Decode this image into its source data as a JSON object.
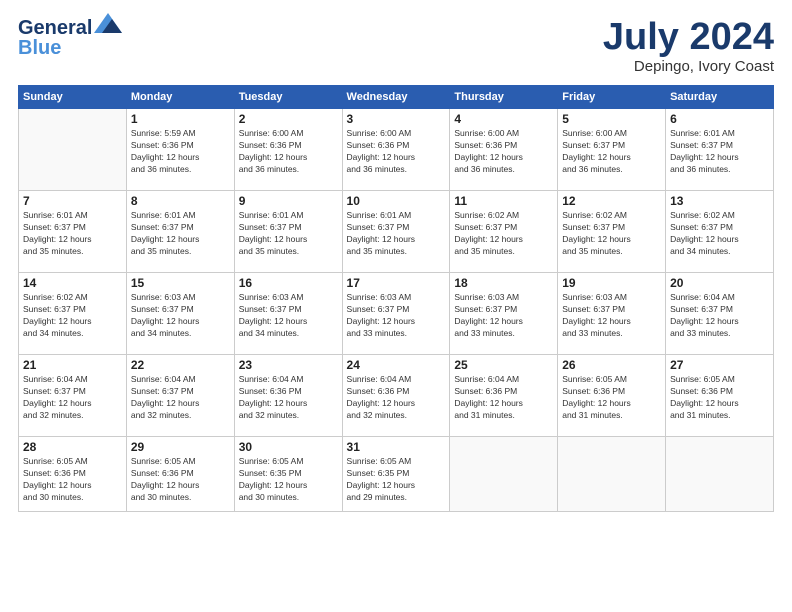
{
  "logo": {
    "line1": "General",
    "line2": "Blue"
  },
  "title": "July 2024",
  "location": "Depingo, Ivory Coast",
  "days_header": [
    "Sunday",
    "Monday",
    "Tuesday",
    "Wednesday",
    "Thursday",
    "Friday",
    "Saturday"
  ],
  "weeks": [
    [
      {
        "num": "",
        "detail": ""
      },
      {
        "num": "1",
        "detail": "Sunrise: 5:59 AM\nSunset: 6:36 PM\nDaylight: 12 hours\nand 36 minutes."
      },
      {
        "num": "2",
        "detail": "Sunrise: 6:00 AM\nSunset: 6:36 PM\nDaylight: 12 hours\nand 36 minutes."
      },
      {
        "num": "3",
        "detail": "Sunrise: 6:00 AM\nSunset: 6:36 PM\nDaylight: 12 hours\nand 36 minutes."
      },
      {
        "num": "4",
        "detail": "Sunrise: 6:00 AM\nSunset: 6:36 PM\nDaylight: 12 hours\nand 36 minutes."
      },
      {
        "num": "5",
        "detail": "Sunrise: 6:00 AM\nSunset: 6:37 PM\nDaylight: 12 hours\nand 36 minutes."
      },
      {
        "num": "6",
        "detail": "Sunrise: 6:01 AM\nSunset: 6:37 PM\nDaylight: 12 hours\nand 36 minutes."
      }
    ],
    [
      {
        "num": "7",
        "detail": "Sunrise: 6:01 AM\nSunset: 6:37 PM\nDaylight: 12 hours\nand 35 minutes."
      },
      {
        "num": "8",
        "detail": "Sunrise: 6:01 AM\nSunset: 6:37 PM\nDaylight: 12 hours\nand 35 minutes."
      },
      {
        "num": "9",
        "detail": "Sunrise: 6:01 AM\nSunset: 6:37 PM\nDaylight: 12 hours\nand 35 minutes."
      },
      {
        "num": "10",
        "detail": "Sunrise: 6:01 AM\nSunset: 6:37 PM\nDaylight: 12 hours\nand 35 minutes."
      },
      {
        "num": "11",
        "detail": "Sunrise: 6:02 AM\nSunset: 6:37 PM\nDaylight: 12 hours\nand 35 minutes."
      },
      {
        "num": "12",
        "detail": "Sunrise: 6:02 AM\nSunset: 6:37 PM\nDaylight: 12 hours\nand 35 minutes."
      },
      {
        "num": "13",
        "detail": "Sunrise: 6:02 AM\nSunset: 6:37 PM\nDaylight: 12 hours\nand 34 minutes."
      }
    ],
    [
      {
        "num": "14",
        "detail": "Sunrise: 6:02 AM\nSunset: 6:37 PM\nDaylight: 12 hours\nand 34 minutes."
      },
      {
        "num": "15",
        "detail": "Sunrise: 6:03 AM\nSunset: 6:37 PM\nDaylight: 12 hours\nand 34 minutes."
      },
      {
        "num": "16",
        "detail": "Sunrise: 6:03 AM\nSunset: 6:37 PM\nDaylight: 12 hours\nand 34 minutes."
      },
      {
        "num": "17",
        "detail": "Sunrise: 6:03 AM\nSunset: 6:37 PM\nDaylight: 12 hours\nand 33 minutes."
      },
      {
        "num": "18",
        "detail": "Sunrise: 6:03 AM\nSunset: 6:37 PM\nDaylight: 12 hours\nand 33 minutes."
      },
      {
        "num": "19",
        "detail": "Sunrise: 6:03 AM\nSunset: 6:37 PM\nDaylight: 12 hours\nand 33 minutes."
      },
      {
        "num": "20",
        "detail": "Sunrise: 6:04 AM\nSunset: 6:37 PM\nDaylight: 12 hours\nand 33 minutes."
      }
    ],
    [
      {
        "num": "21",
        "detail": "Sunrise: 6:04 AM\nSunset: 6:37 PM\nDaylight: 12 hours\nand 32 minutes."
      },
      {
        "num": "22",
        "detail": "Sunrise: 6:04 AM\nSunset: 6:37 PM\nDaylight: 12 hours\nand 32 minutes."
      },
      {
        "num": "23",
        "detail": "Sunrise: 6:04 AM\nSunset: 6:36 PM\nDaylight: 12 hours\nand 32 minutes."
      },
      {
        "num": "24",
        "detail": "Sunrise: 6:04 AM\nSunset: 6:36 PM\nDaylight: 12 hours\nand 32 minutes."
      },
      {
        "num": "25",
        "detail": "Sunrise: 6:04 AM\nSunset: 6:36 PM\nDaylight: 12 hours\nand 31 minutes."
      },
      {
        "num": "26",
        "detail": "Sunrise: 6:05 AM\nSunset: 6:36 PM\nDaylight: 12 hours\nand 31 minutes."
      },
      {
        "num": "27",
        "detail": "Sunrise: 6:05 AM\nSunset: 6:36 PM\nDaylight: 12 hours\nand 31 minutes."
      }
    ],
    [
      {
        "num": "28",
        "detail": "Sunrise: 6:05 AM\nSunset: 6:36 PM\nDaylight: 12 hours\nand 30 minutes."
      },
      {
        "num": "29",
        "detail": "Sunrise: 6:05 AM\nSunset: 6:36 PM\nDaylight: 12 hours\nand 30 minutes."
      },
      {
        "num": "30",
        "detail": "Sunrise: 6:05 AM\nSunset: 6:35 PM\nDaylight: 12 hours\nand 30 minutes."
      },
      {
        "num": "31",
        "detail": "Sunrise: 6:05 AM\nSunset: 6:35 PM\nDaylight: 12 hours\nand 29 minutes."
      },
      {
        "num": "",
        "detail": ""
      },
      {
        "num": "",
        "detail": ""
      },
      {
        "num": "",
        "detail": ""
      }
    ]
  ]
}
